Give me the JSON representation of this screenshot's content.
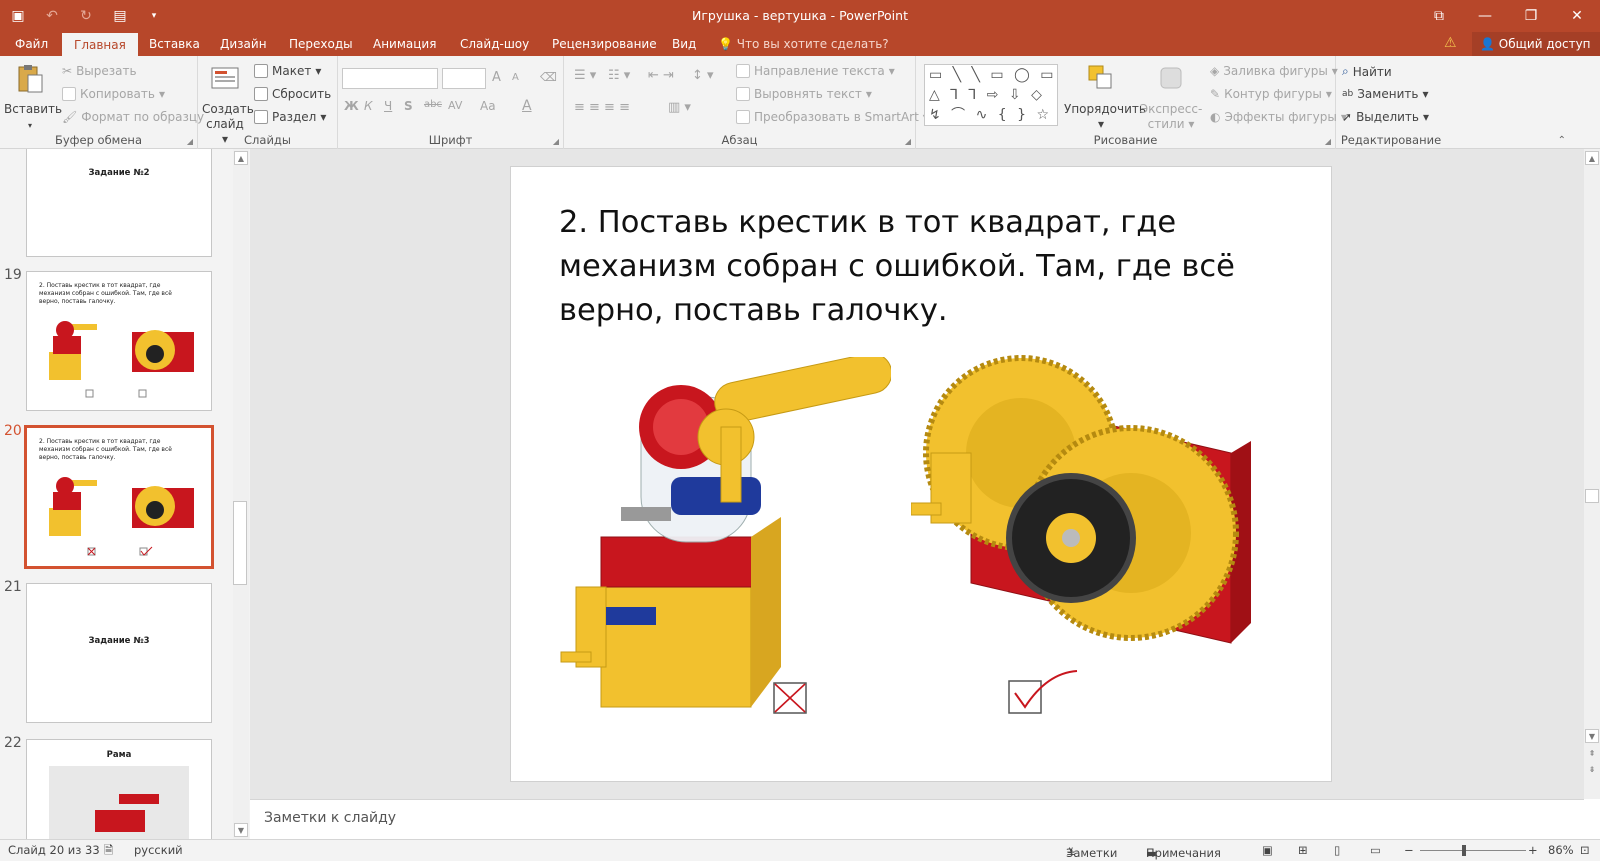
{
  "window": {
    "title": "Игрушка - вертушка - PowerPoint",
    "controls": {
      "ribbon_display": "⧉",
      "minimize": "—",
      "restore": "❐",
      "close": "✕"
    }
  },
  "qat": {
    "save_icon": "save-icon",
    "undo_icon": "undo-icon",
    "redo_icon": "redo-icon",
    "present_icon": "slideshow-icon",
    "customize": "customize-icon"
  },
  "tabs": [
    {
      "label": "Файл"
    },
    {
      "label": "Главная"
    },
    {
      "label": "Вставка"
    },
    {
      "label": "Дизайн"
    },
    {
      "label": "Переходы"
    },
    {
      "label": "Анимация"
    },
    {
      "label": "Слайд-шоу"
    },
    {
      "label": "Рецензирование"
    },
    {
      "label": "Вид"
    }
  ],
  "tell_me": "Что вы хотите сделать?",
  "share": "Общий доступ",
  "ribbon": {
    "clipboard": {
      "paste": "Вставить",
      "cut": "Вырезать",
      "copy": "Копировать",
      "format_painter": "Формат по образцу",
      "label": "Буфер обмена"
    },
    "slides": {
      "new_slide": "Создать слайд",
      "layout": "Макет",
      "reset": "Сбросить",
      "section": "Раздел",
      "label": "Слайды"
    },
    "font": {
      "label": "Шрифт",
      "bold": "Ж",
      "italic": "К",
      "underline": "Ч",
      "shadow": "S",
      "strike": "abc",
      "spacing": "AV",
      "case": "Aa",
      "color": "A",
      "grow": "A",
      "shrink": "A"
    },
    "paragraph": {
      "label": "Абзац",
      "text_direction": "Направление текста",
      "align_text": "Выровнять текст",
      "smartart": "Преобразовать в SmartArt"
    },
    "drawing": {
      "label": "Рисование",
      "arrange": "Упорядочить",
      "quick_styles": "Экспресс-стили",
      "fill": "Заливка фигуры",
      "outline": "Контур фигуры",
      "effects": "Эффекты фигуры",
      "shapes_gallery": "▭ ╲ ╲ ▭ ◯ ▭ △ ⅂ ⅂ ⇨ ⇩ ◇ ↯ ⌒ ∿ { } ☆"
    },
    "editing": {
      "label": "Редактирование",
      "find": "Найти",
      "replace": "Заменить",
      "select": "Выделить"
    }
  },
  "thumbnails": [
    {
      "num": "",
      "title": "Задание №2"
    },
    {
      "num": "19",
      "text": "2. Поставь крестик в тот квадрат, где механизм собран с ошибкой. Там, где всё верно, поставь галочку."
    },
    {
      "num": "20",
      "text": "2. Поставь крестик в тот квадрат, где механизм собран с ошибкой. Там, где всё верно, поставь галочку."
    },
    {
      "num": "21",
      "title": "Задание №3"
    },
    {
      "num": "22",
      "title": "Рама"
    }
  ],
  "slide": {
    "title": "2. Поставь крестик в тот квадрат, где механизм собран с ошибкой. Там, где всё верно, поставь галочку.",
    "left_mark": "cross",
    "right_mark": "check",
    "colors": {
      "red": "#c8161e",
      "yellow": "#f2c12e",
      "blue": "#1f3a9c",
      "black": "#222222"
    }
  },
  "notes_placeholder": "Заметки к слайду",
  "status": {
    "slide_info": "Слайд 20 из 33",
    "language": "русский",
    "notes": "Заметки",
    "comments": "Примечания",
    "zoom": "86%"
  },
  "accent": "#b7472a"
}
